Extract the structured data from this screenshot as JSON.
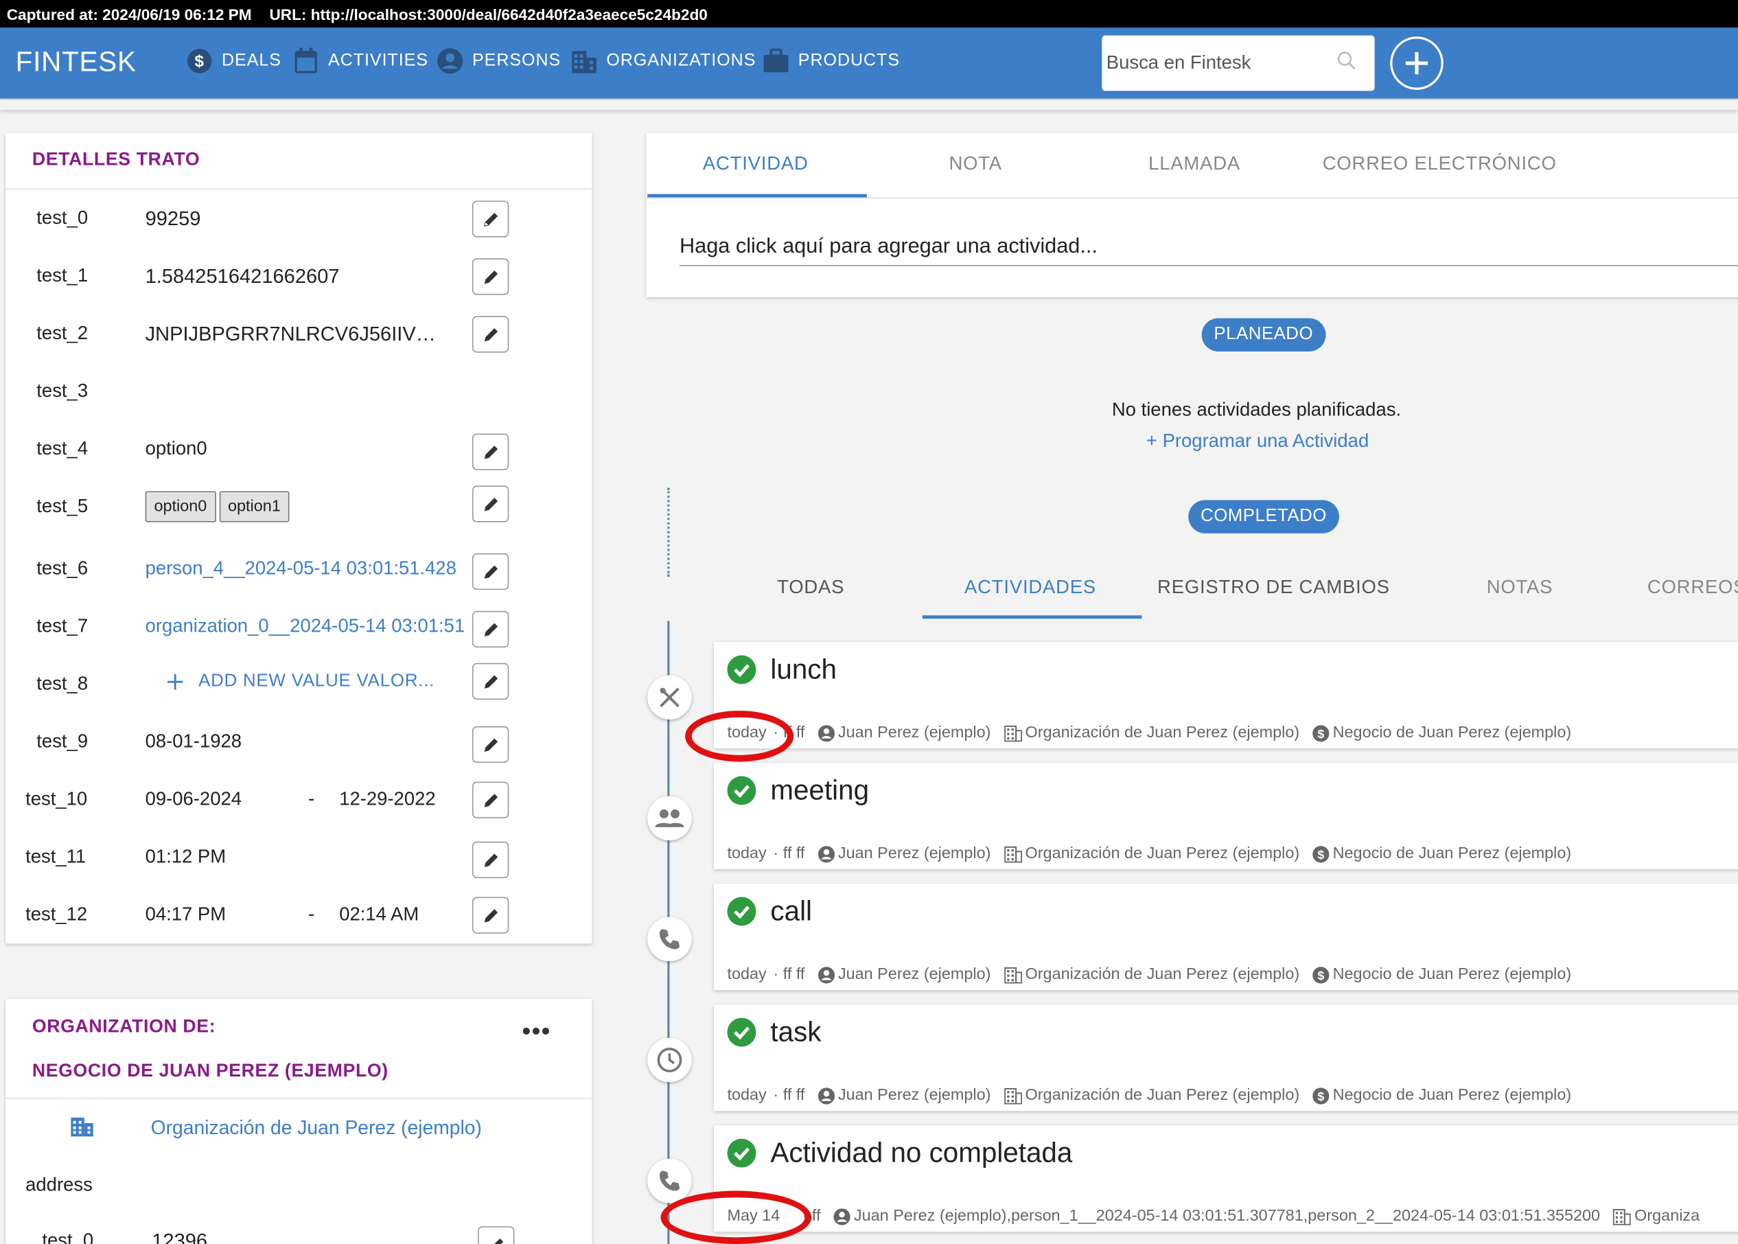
{
  "capture": {
    "captured_at": "Captured at: 2024/06/19 06:12 PM",
    "url": "URL: http://localhost:3000/deal/6642d40f2a3eaece5c24b2d0"
  },
  "nav": {
    "brand": "FINTESK",
    "items": [
      "DEALS",
      "ACTIVITIES",
      "PERSONS",
      "ORGANIZATIONS",
      "PRODUCTS"
    ],
    "search_placeholder": "Busca en Fintesk"
  },
  "details": {
    "title": "DETALLES TRATO",
    "rows": [
      {
        "key": "test_0",
        "value": "99259"
      },
      {
        "key": "test_1",
        "value": "1.5842516421662607"
      },
      {
        "key": "test_2",
        "value": "JNPIJBPGRR7NLRCV6J56IIV…"
      },
      {
        "key": "test_3",
        "value": ""
      },
      {
        "key": "test_4",
        "value": "option0"
      },
      {
        "key": "test_5",
        "chips": [
          "option0",
          "option1"
        ]
      },
      {
        "key": "test_6",
        "value": "person_4__2024-05-14 03:01:51.428"
      },
      {
        "key": "test_7",
        "value": "organization_0__2024-05-14 03:01:51"
      },
      {
        "key": "test_8",
        "value": "ADD NEW VALUE VALOR..."
      },
      {
        "key": "test_9",
        "value": "08-01-1928"
      },
      {
        "key": "test_10",
        "value": "09-06-2024",
        "sep": "-",
        "value2": "12-29-2022"
      },
      {
        "key": "test_11",
        "value": "01:12 PM"
      },
      {
        "key": "test_12",
        "value": "04:17 PM",
        "sep": "-",
        "value2": "02:14 AM"
      }
    ]
  },
  "org": {
    "title1": "ORGANIZATION DE:",
    "title2": "NEGOCIO DE JUAN PEREZ (EJEMPLO)",
    "link": "Organización de Juan Perez (ejemplo)",
    "address_label": "address",
    "row_key": "test_0",
    "row_value": "12396"
  },
  "compose": {
    "tabs": [
      "ACTIVIDAD",
      "NOTA",
      "LLAMADA",
      "CORREO ELECTRÓNICO"
    ],
    "placeholder": "Haga click aquí para agregar una actividad..."
  },
  "planned": {
    "badge": "PLANEADO",
    "empty": "No tienes actividades planificadas.",
    "schedule_link": "+ Programar una Actividad"
  },
  "completed": {
    "badge": "COMPLETADO",
    "filters": [
      "TODAS",
      "ACTIVIDADES",
      "REGISTRO DE CAMBIOS",
      "NOTAS",
      "CORREOS"
    ]
  },
  "activities": [
    {
      "title": "lunch",
      "when": "today",
      "owner": "· ff ff",
      "person": "Juan Perez (ejemplo)",
      "org": "Organización de Juan Perez (ejemplo)",
      "deal": "Negocio de Juan Perez (ejemplo)",
      "icon": "restaurant-icon"
    },
    {
      "title": "meeting",
      "when": "today",
      "owner": "· ff ff",
      "person": "Juan Perez (ejemplo)",
      "org": "Organización de Juan Perez (ejemplo)",
      "deal": "Negocio de Juan Perez (ejemplo)",
      "icon": "people-icon"
    },
    {
      "title": "call",
      "when": "today",
      "owner": "· ff ff",
      "person": "Juan Perez (ejemplo)",
      "org": "Organización de Juan Perez (ejemplo)",
      "deal": "Negocio de Juan Perez (ejemplo)",
      "icon": "phone-icon"
    },
    {
      "title": "task",
      "when": "today",
      "owner": "· ff ff",
      "person": "Juan Perez (ejemplo)",
      "org": "Organización de Juan Perez (ejemplo)",
      "deal": "Negocio de Juan Perez (ejemplo)",
      "icon": "clock-icon"
    },
    {
      "title": "Actividad no completada",
      "when": "May 14",
      "owner": "· ff",
      "person": "Juan Perez (ejemplo),person_1__2024-05-14 03:01:51.307781,person_2__2024-05-14 03:01:51.355200",
      "org": "Organiza",
      "deal": "",
      "icon": "phone-icon"
    }
  ],
  "colors": {
    "primary": "#3d7ec8",
    "title_purple": "#8a1a8a",
    "success": "#2e9c3e",
    "annotation": "#e01010"
  }
}
